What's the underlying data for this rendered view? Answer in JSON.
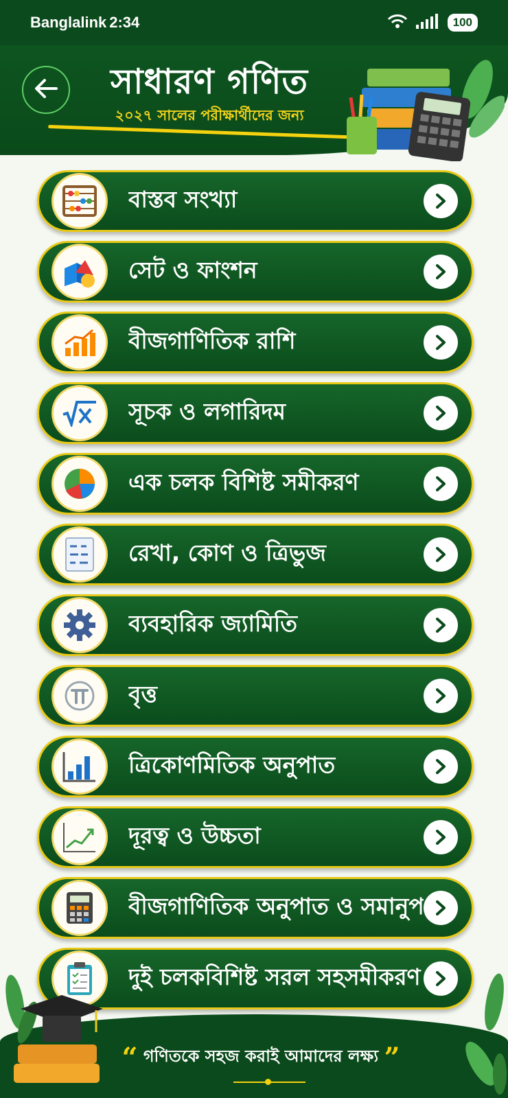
{
  "status_bar": {
    "carrier": "Banglalink",
    "time": "2:34",
    "battery": "100"
  },
  "header": {
    "title": "সাধারণ গণিত",
    "subtitle": "২০২৭ সালের পরীক্ষার্থীদের জন্য"
  },
  "chapters": [
    {
      "label": "বাস্তব সংখ্যা",
      "icon": "abacus-icon"
    },
    {
      "label": "সেট ও ফাংশন",
      "icon": "shapes-icon"
    },
    {
      "label": "বীজগাণিতিক রাশি",
      "icon": "bar-growth-icon"
    },
    {
      "label": "সূচক ও লগারিদম",
      "icon": "square-root-icon"
    },
    {
      "label": "এক চলক বিশিষ্ট সমীকরণ",
      "icon": "pie-chart-icon"
    },
    {
      "label": "রেখা, কোণ ও ত্রিভুজ",
      "icon": "formula-sheet-icon"
    },
    {
      "label": "ব্যবহারিক জ্যামিতি",
      "icon": "gear-icon"
    },
    {
      "label": "বৃত্ত",
      "icon": "pi-icon"
    },
    {
      "label": "ত্রিকোণমিতিক অনুপাত",
      "icon": "bar-chart-icon"
    },
    {
      "label": "দূরত্ব ও উচ্চতা",
      "icon": "line-graph-icon"
    },
    {
      "label": "বীজগাণিতিক অনুপাত ও সমানুপাত",
      "icon": "calculator-icon"
    },
    {
      "label": "দুই চলকবিশিষ্ট সরল সহসমীকরণ",
      "icon": "clipboard-icon"
    }
  ],
  "footer": {
    "quote": "গণিতকে সহজ করাই আমাদের লক্ষ্য"
  }
}
